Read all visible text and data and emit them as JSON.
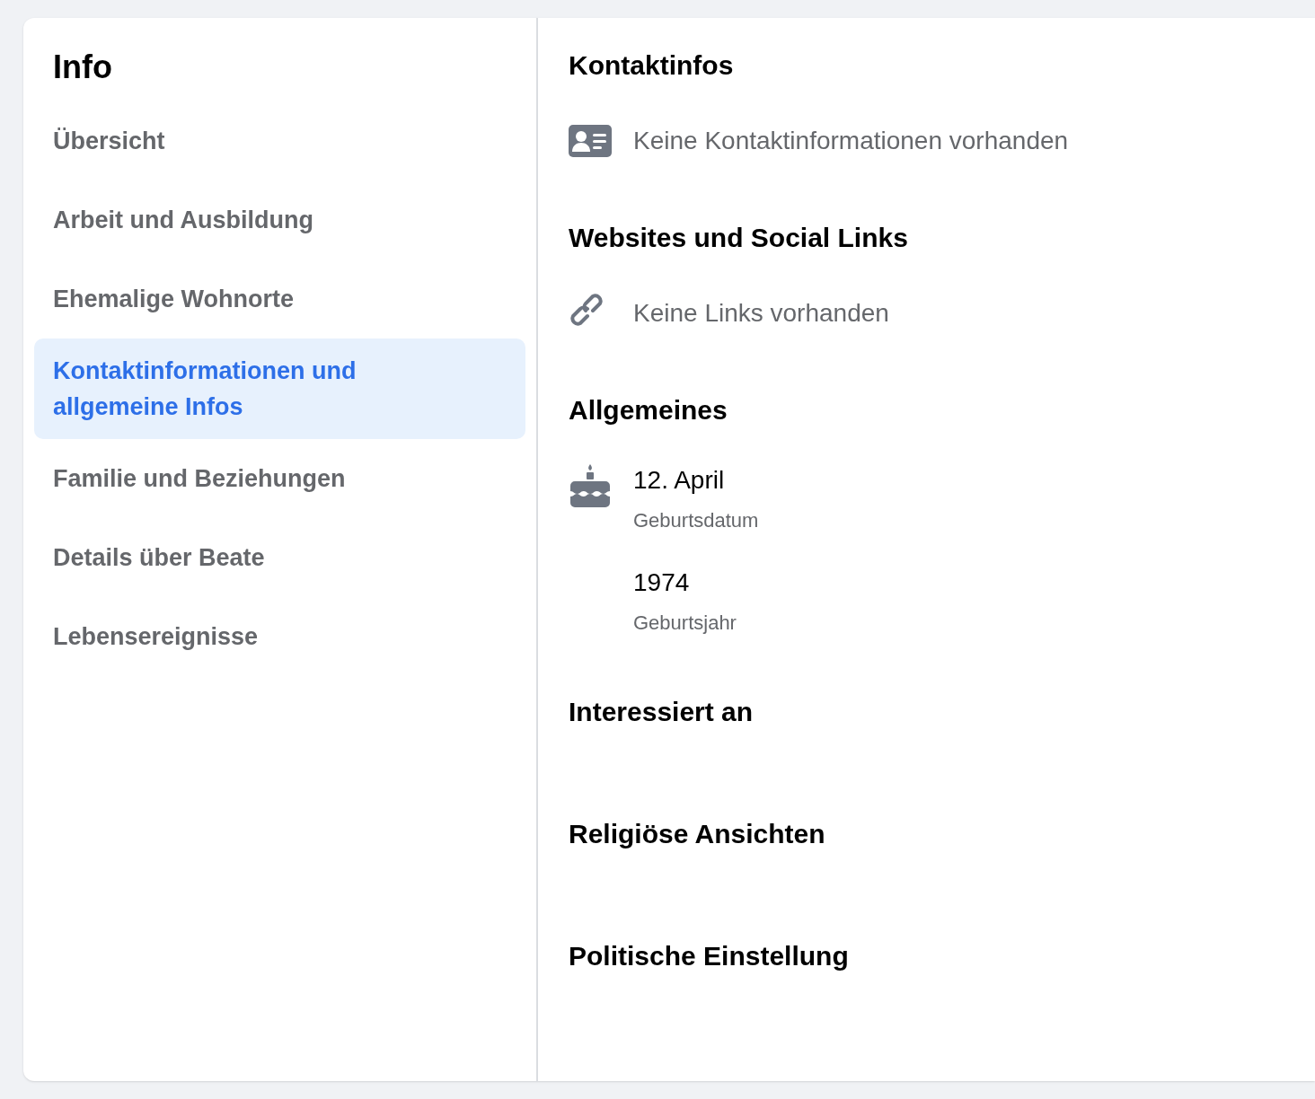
{
  "sidebar": {
    "title": "Info",
    "items": [
      {
        "label": "Übersicht",
        "selected": false
      },
      {
        "label": "Arbeit und Ausbildung",
        "selected": false
      },
      {
        "label": "Ehemalige Wohnorte",
        "selected": false
      },
      {
        "label": "Kontaktinformationen und allgemeine Infos",
        "selected": true
      },
      {
        "label": "Familie und Beziehungen",
        "selected": false
      },
      {
        "label": "Details über Beate",
        "selected": false
      },
      {
        "label": "Lebensereignisse",
        "selected": false
      }
    ]
  },
  "sections": [
    {
      "heading": "Kontaktinfos",
      "items": [
        {
          "kind": "contact",
          "text": "Keine Kontaktinformationen vorhanden"
        }
      ]
    },
    {
      "heading": "Websites und Social Links",
      "items": [
        {
          "kind": "link",
          "text": "Keine Links vorhanden"
        }
      ]
    },
    {
      "heading": "Allgemeines",
      "items": [
        {
          "kind": "birthday",
          "value": "12. April",
          "caption": "Geburtsdatum"
        },
        {
          "kind": "year",
          "value": "1974",
          "caption": "Geburtsjahr"
        }
      ]
    },
    {
      "heading": "Interessiert an"
    },
    {
      "heading": "Religiöse Ansichten"
    },
    {
      "heading": "Politische Einstellung"
    }
  ]
}
